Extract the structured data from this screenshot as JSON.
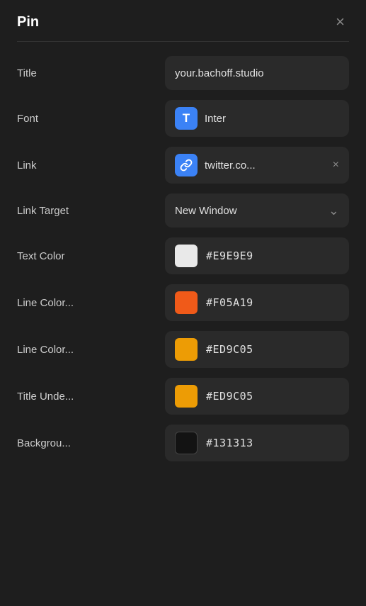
{
  "panel": {
    "title": "Pin",
    "close_label": "×"
  },
  "fields": {
    "title_label": "Title",
    "title_value": "your.bachoff.studio",
    "font_label": "Font",
    "font_icon_letter": "T",
    "font_value": "Inter",
    "link_label": "Link",
    "link_icon": "🔗",
    "link_value": "twitter.co...",
    "link_target_label": "Link Target",
    "link_target_value": "New Window",
    "text_color_label": "Text Color",
    "text_color_hex": "#E9E9E9",
    "text_color_swatch": "#E9E9E9",
    "line_color1_label": "Line Color...",
    "line_color1_hex": "#F05A19",
    "line_color1_swatch": "#F05A19",
    "line_color2_label": "Line Color...",
    "line_color2_hex": "#ED9C05",
    "line_color2_swatch": "#ED9C05",
    "title_under_label": "Title Unde...",
    "title_under_hex": "#ED9C05",
    "title_under_swatch": "#ED9C05",
    "background_label": "Backgrou...",
    "background_hex": "#131313",
    "background_swatch": "#131313"
  }
}
